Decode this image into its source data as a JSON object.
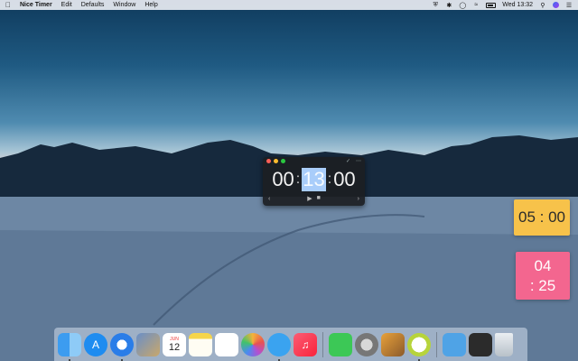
{
  "menubar": {
    "app_name": "Nice Timer",
    "menus": [
      "Edit",
      "Defaults",
      "Window",
      "Help"
    ],
    "clock": "Wed 13:32"
  },
  "timer_window": {
    "hours": "00",
    "minutes": "13",
    "seconds": "00",
    "separator": ":"
  },
  "tiles": {
    "yellow": {
      "text": "05 : 00",
      "color": "#f7c24a"
    },
    "pink": {
      "line1": "04",
      "line2": ": 25",
      "color": "#f3668f"
    }
  },
  "calendar_icon": {
    "month": "JUN",
    "day": "12"
  },
  "icons": {
    "apple": "apple-icon",
    "shield": "shield-icon",
    "bluetooth": "bluetooth-icon",
    "timer": "timer-icon",
    "wifi": "wifi-icon",
    "battery": "battery-icon",
    "search": "search-icon",
    "siri": "siri-icon",
    "list": "list-icon"
  },
  "dock": [
    {
      "name": "finder",
      "running": true
    },
    {
      "name": "app-store",
      "running": false
    },
    {
      "name": "safari",
      "running": true
    },
    {
      "name": "photo-app",
      "running": false
    },
    {
      "name": "calendar",
      "running": false
    },
    {
      "name": "notes",
      "running": false
    },
    {
      "name": "reminders",
      "running": false
    },
    {
      "name": "photos",
      "running": false
    },
    {
      "name": "messages",
      "running": true
    },
    {
      "name": "music",
      "running": false
    },
    {
      "name": "facetime",
      "running": false
    },
    {
      "name": "system-preferences",
      "running": false
    },
    {
      "name": "preview",
      "running": false
    },
    {
      "name": "nice-timer",
      "running": true
    },
    {
      "name": "downloads",
      "running": false
    },
    {
      "name": "screens",
      "running": false
    },
    {
      "name": "trash",
      "running": false
    }
  ]
}
